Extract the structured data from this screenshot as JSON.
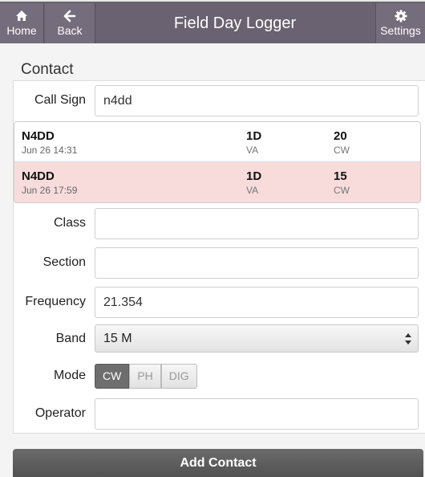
{
  "header": {
    "home_label": "Home",
    "back_label": "Back",
    "title": "Field Day Logger",
    "settings_label": "Settings"
  },
  "section_title": "Contact",
  "call_sign": {
    "label": "Call Sign",
    "value": "n4dd"
  },
  "history": [
    {
      "call": "N4DD",
      "time": "Jun 26 14:31",
      "class": "1D",
      "section": "VA",
      "band": "20",
      "mode": "CW",
      "highlighted": false
    },
    {
      "call": "N4DD",
      "time": "Jun 26 17:59",
      "class": "1D",
      "section": "VA",
      "band": "15",
      "mode": "CW",
      "highlighted": true
    }
  ],
  "class_field": {
    "label": "Class",
    "value": ""
  },
  "section_field": {
    "label": "Section",
    "value": ""
  },
  "frequency": {
    "label": "Frequency",
    "value": "21.354"
  },
  "band": {
    "label": "Band",
    "selected": "15 M"
  },
  "mode": {
    "label": "Mode",
    "options": [
      "CW",
      "PH",
      "DIG"
    ],
    "selected": "CW"
  },
  "operator": {
    "label": "Operator",
    "value": ""
  },
  "add_button": "Add Contact",
  "colors": {
    "header": "#6a6270",
    "highlight_row": "#f8dcdc",
    "active_mode": "#6e6e6e"
  }
}
